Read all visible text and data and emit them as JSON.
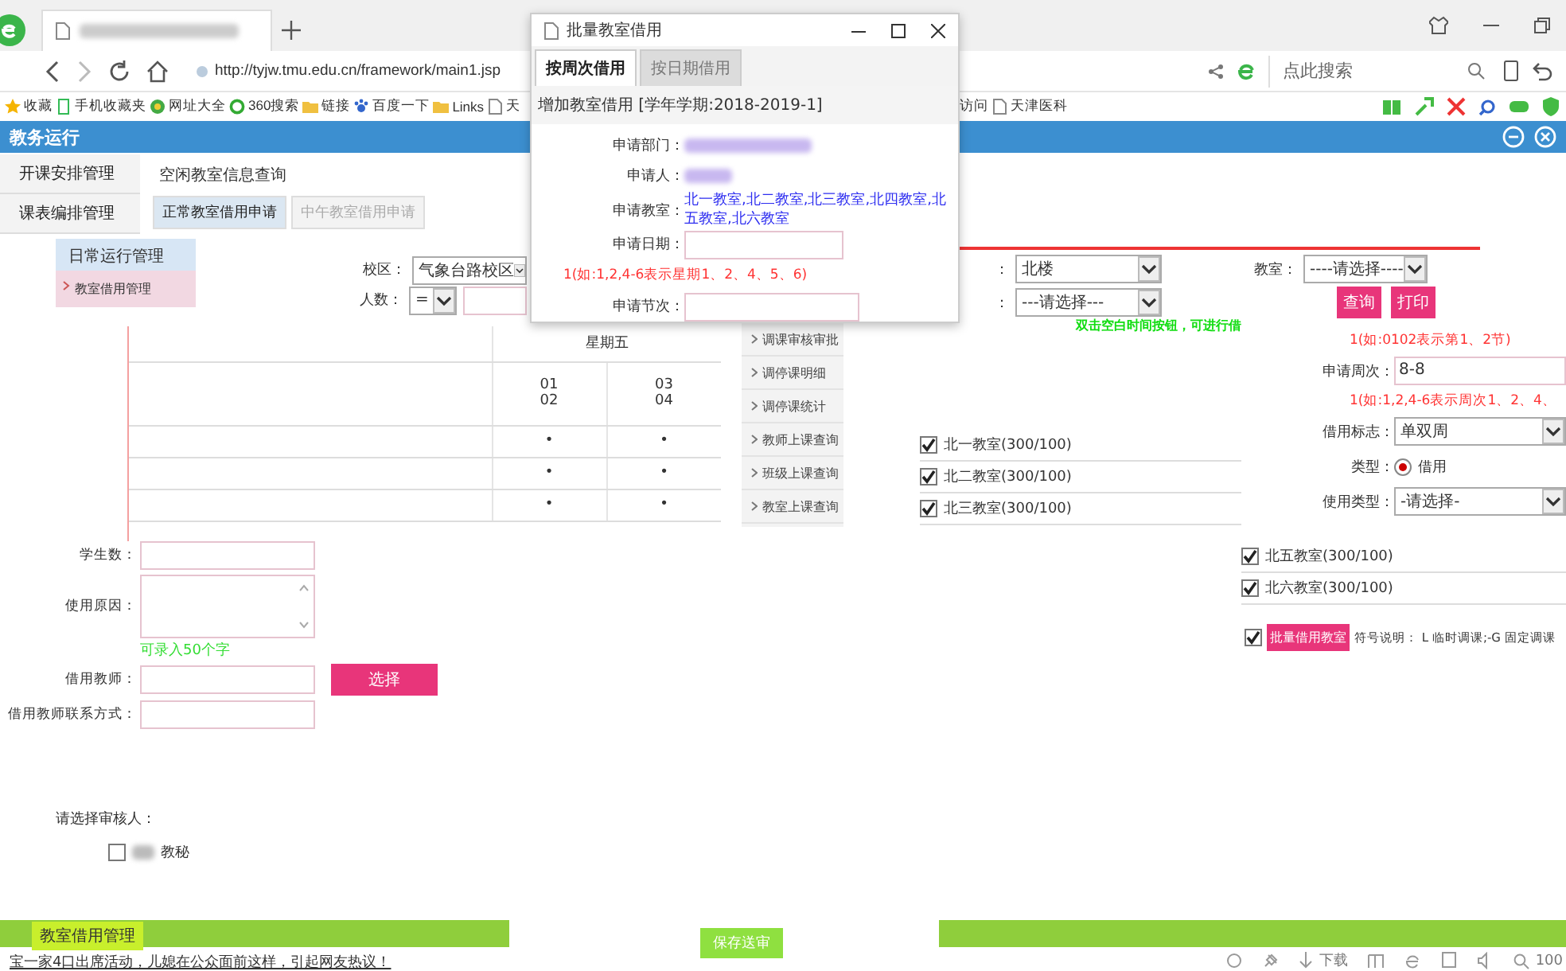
{
  "browser": {
    "address": "http://tyjw.tmu.edu.cn/framework/main1.jsp",
    "search_placeholder": "点此搜索",
    "bookmarks": [
      {
        "label": "收藏",
        "kind": "star"
      },
      {
        "label": "手机收藏夹",
        "kind": "phone"
      },
      {
        "label": "网址大全",
        "kind": "globe"
      },
      {
        "label": "360搜索",
        "kind": "ring"
      },
      {
        "label": "链接",
        "kind": "folder"
      },
      {
        "label": "百度一下",
        "kind": "paw"
      },
      {
        "label": "Links",
        "kind": "folder"
      },
      {
        "label": "天",
        "kind": "page"
      }
    ],
    "bookmarks_right": [
      {
        "label": "访问",
        "kind": "none"
      },
      {
        "label": "天津医科",
        "kind": "page"
      }
    ],
    "status": [
      "下载",
      "100"
    ]
  },
  "app": {
    "title": "教务运行"
  },
  "sidebar": {
    "items": [
      {
        "label": "开课安排管理",
        "selected": false
      },
      {
        "label": "课表编排管理",
        "selected": false
      }
    ]
  },
  "submenu": {
    "title": "日常运行管理",
    "items": [
      {
        "label": "教室借用管理",
        "selected": true
      }
    ]
  },
  "page": {
    "title": "空闲教室信息查询",
    "tabs": [
      {
        "label": "正常教室借用申请",
        "selected": true
      },
      {
        "label": "中午教室借用申请",
        "selected": false
      }
    ]
  },
  "filters_left": [
    {
      "label": "校区：",
      "value": "气象台路校区",
      "kind": "select"
    },
    {
      "label": "人数：",
      "value": "=",
      "kind": "select-input"
    }
  ],
  "filters_right": [
    {
      "label": "：",
      "value": "北楼"
    },
    {
      "label": "：",
      "value": "---请选择---"
    }
  ],
  "room_filter": {
    "label": "教室：",
    "value": "----请选择----"
  },
  "filter_buttons": [
    "查询",
    "打印"
  ],
  "hint": "双击空白时间按钮，可进行借",
  "timetable": {
    "day": "星期五",
    "periods": [
      [
        "01",
        "02"
      ],
      [
        "03",
        "04"
      ]
    ],
    "rows": [
      [
        "•",
        "•"
      ],
      [
        "•",
        "•"
      ],
      [
        "•",
        "•"
      ]
    ]
  },
  "menu_links": [
    "调课审核审批",
    "调停课明细",
    "调停课统计",
    "教师上课查询",
    "班级上课查询",
    "教室上课查询"
  ],
  "rooms": [
    {
      "label": "北一教室(300/100)",
      "checked": true
    },
    {
      "label": "北二教室(300/100)",
      "checked": true
    },
    {
      "label": "北三教室(300/100)",
      "checked": true
    }
  ],
  "rooms_right": [
    {
      "label": "北五教室(300/100)",
      "checked": true
    },
    {
      "label": "北六教室(300/100)",
      "checked": true
    }
  ],
  "dialog": {
    "title": "批量教室借用",
    "tabs": [
      {
        "label": "按周次借用",
        "selected": true
      },
      {
        "label": "按日期借用",
        "selected": false
      }
    ],
    "heading": "增加教室借用 [学年学期:2018-2019-1]",
    "fields": [
      {
        "label": "申请部门：",
        "kind": "blurred"
      },
      {
        "label": "申请人：",
        "kind": "blurred"
      },
      {
        "label": "申请教室：",
        "kind": "link",
        "value": "北一教室,北二教室,北三教室,北四教室,北五教室,北六教室"
      },
      {
        "label": "申请日期：",
        "kind": "input"
      }
    ],
    "date_hint": "1(如:1,2,4-6表示星期1、2、4、5、6)",
    "period_label": "申请节次："
  },
  "right_form": {
    "period_hint": "1(如:0102表示第1、2节)",
    "week_label": "申请周次：",
    "week_value": "8-8",
    "week_hint": "1(如:1,2,4-6表示周次1、2、4、",
    "flag_label": "借用标志：",
    "flag_value": "单双周",
    "type_label": "类型：",
    "type_option": {
      "label": "借用",
      "selected": true
    },
    "use_label": "使用类型：",
    "use_value": "-请选择-"
  },
  "batch": {
    "checked": true,
    "button": "批量借用教室",
    "legend": "符号说明： L 临时调课;-G 固定调课"
  },
  "lower_form": {
    "fields": [
      {
        "label": "学生数：",
        "kind": "input"
      },
      {
        "label": "使用原因：",
        "kind": "textarea"
      },
      {
        "label": "借用教师：",
        "kind": "pick"
      },
      {
        "label": "借用教师联系方式：",
        "kind": "input"
      }
    ],
    "note": "可录入50个字",
    "pick_button": "选择",
    "reviewer_label": "请选择审核人：",
    "reviewers": [
      {
        "label": "教秘",
        "checked": false
      }
    ]
  },
  "save_button": "保存送审",
  "footer": {
    "tab": "教室借用管理",
    "news": "宝一家4口出席活动，儿媳在公众面前这样，引起网友热议！"
  }
}
